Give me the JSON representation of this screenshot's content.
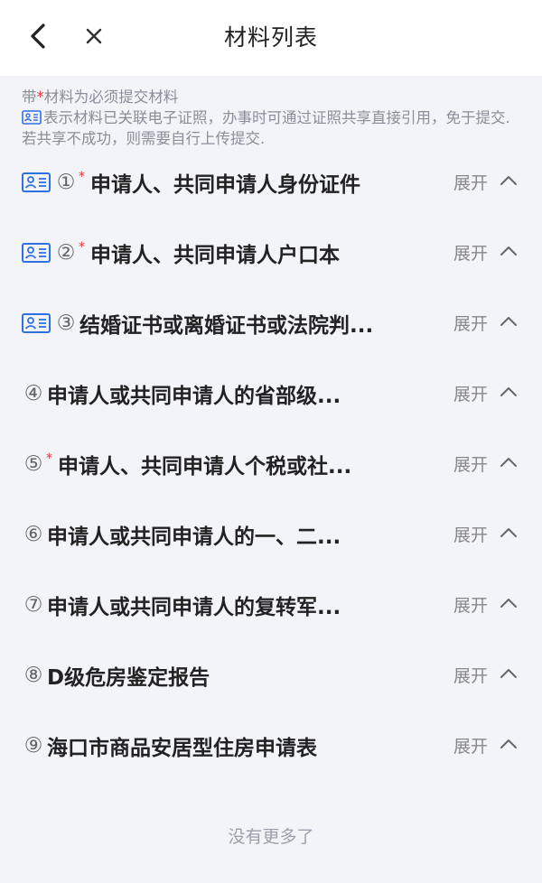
{
  "header": {
    "title": "材料列表",
    "back_icon": "chevron-left-icon",
    "close_icon": "close-icon"
  },
  "notice": {
    "line1_prefix": "带",
    "line1_star": "*",
    "line1_suffix": "材料为必须提交材料",
    "line2": "表示材料已关联电子证照，办事时可通过证照共享直接引用，免于提交.若共享不成功，则需要自行上传提交."
  },
  "expand_label": "展开",
  "items": [
    {
      "num": "①",
      "title": "申请人、共同申请人身份证件",
      "required": true,
      "cert": true
    },
    {
      "num": "②",
      "title": "申请人、共同申请人户口本",
      "required": true,
      "cert": true
    },
    {
      "num": "③",
      "title": "结婚证书或离婚证书或法院判...",
      "required": false,
      "cert": true
    },
    {
      "num": "④",
      "title": "申请人或共同申请人的省部级...",
      "required": false,
      "cert": false
    },
    {
      "num": "⑤",
      "title": "申请人、共同申请人个税或社...",
      "required": true,
      "cert": false
    },
    {
      "num": "⑥",
      "title": "申请人或共同申请人的一、二...",
      "required": false,
      "cert": false
    },
    {
      "num": "⑦",
      "title": "申请人或共同申请人的复转军...",
      "required": false,
      "cert": false
    },
    {
      "num": "⑧",
      "title": "D级危房鉴定报告",
      "required": false,
      "cert": false
    },
    {
      "num": "⑨",
      "title": "海口市商品安居型住房申请表",
      "required": false,
      "cert": false
    }
  ],
  "required_mark": "*",
  "footer": "没有更多了",
  "colors": {
    "accent": "#2f6fe4",
    "required": "#e8333b",
    "background": "#f3f4f8"
  }
}
